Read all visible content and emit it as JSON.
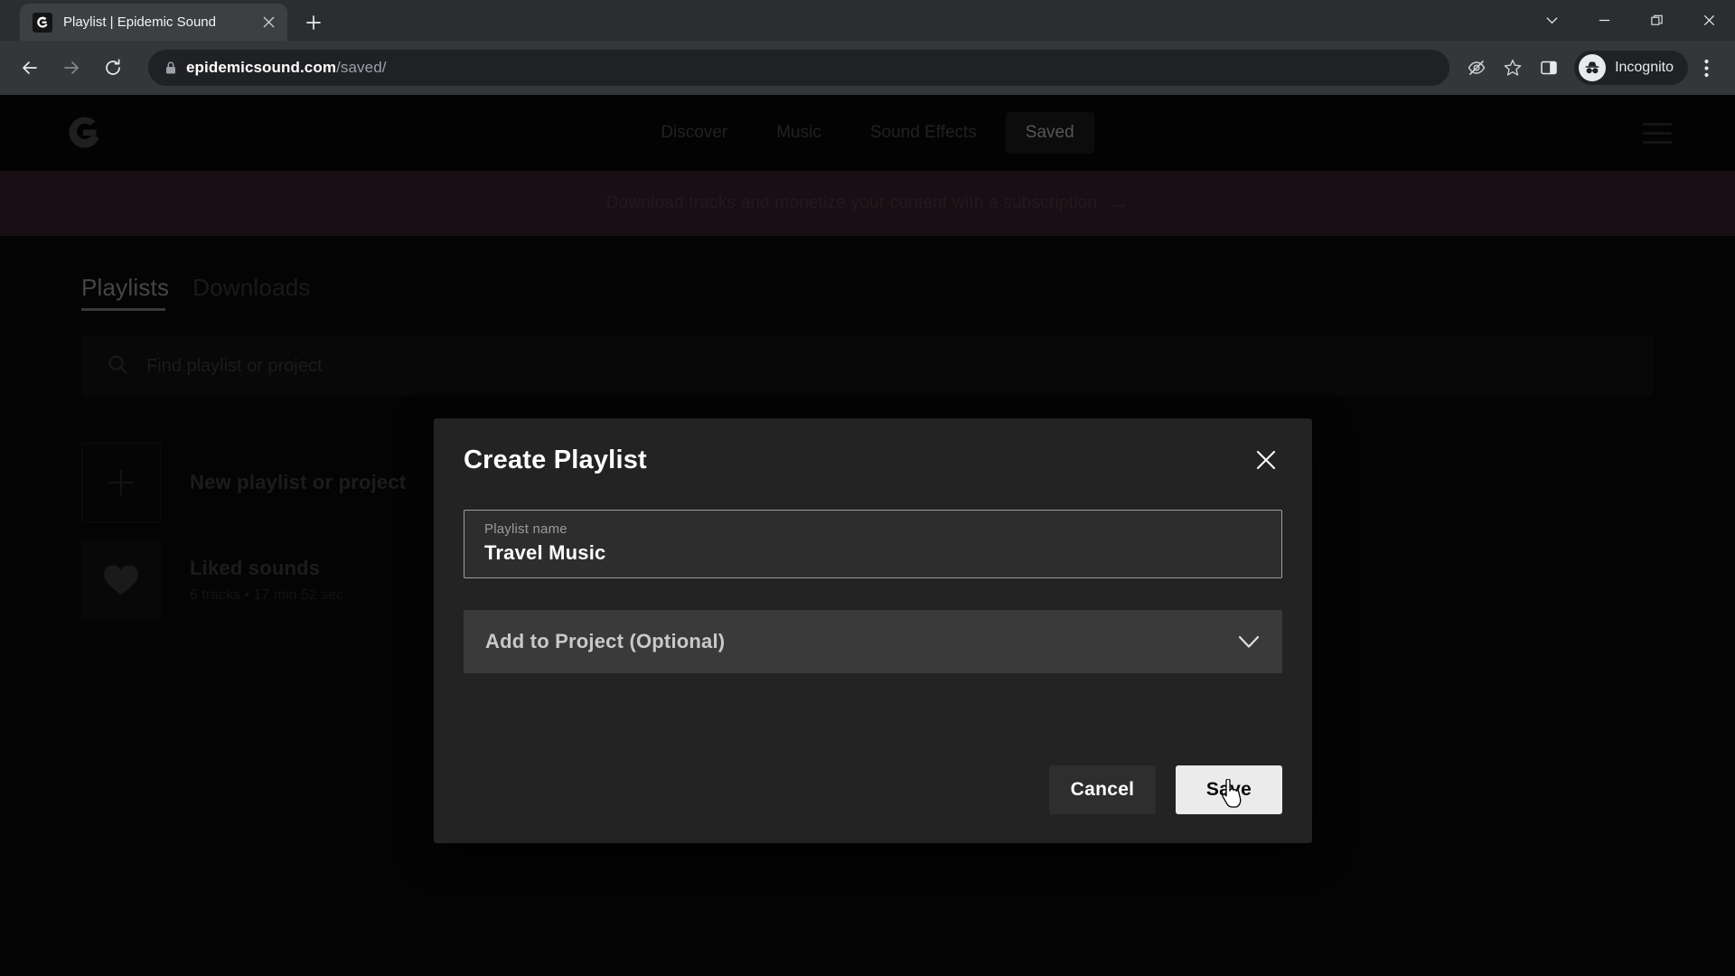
{
  "browser": {
    "tab": {
      "title": "Playlist | Epidemic Sound",
      "favicon_icon": "epidemic-sound-favicon",
      "close_icon": "close-icon"
    },
    "new_tab_label": "+",
    "window_controls": [
      {
        "name": "tab-search",
        "icon": "chevron-down-icon",
        "glyph": ""
      },
      {
        "name": "minimize",
        "icon": "minimize-icon",
        "glyph": ""
      },
      {
        "name": "maximize",
        "icon": "restore-icon",
        "glyph": ""
      },
      {
        "name": "close-window",
        "icon": "close-icon",
        "glyph": ""
      }
    ],
    "toolbar": {
      "back_icon": "back-arrow-icon",
      "forward_icon": "forward-arrow-icon",
      "reload_icon": "reload-icon",
      "lock_icon": "lock-icon",
      "url_domain": "epidemicsound.com",
      "url_path": "/saved/",
      "third_party_cookies_icon": "eye-slash-icon",
      "bookmark_icon": "star-icon",
      "side_panel_icon": "side-panel-icon",
      "incognito_label": "Incognito",
      "incognito_icon": "incognito-hat-icon",
      "menu_icon": "three-dot-menu-icon"
    }
  },
  "site": {
    "logo_icon": "epidemic-sound-logo",
    "nav": [
      {
        "label": "Discover",
        "active": false
      },
      {
        "label": "Music",
        "active": false
      },
      {
        "label": "Sound Effects",
        "active": false
      },
      {
        "label": "Saved",
        "active": true
      }
    ],
    "menu_icon": "hamburger-menu-icon",
    "promo": {
      "text": "Download tracks and monetize your content with a subscription",
      "arrow": "→",
      "bg_color": "#36212c"
    },
    "tabs": [
      {
        "label": "Playlists",
        "active": true
      },
      {
        "label": "Downloads",
        "active": false
      }
    ],
    "search": {
      "placeholder": "Find playlist or project",
      "icon": "search-icon",
      "value": ""
    },
    "playlists": [
      {
        "icon": "plus-icon",
        "title": "New playlist or project",
        "subtitle": ""
      },
      {
        "icon": "heart-icon",
        "title": "Liked sounds",
        "subtitle": "6 tracks • 17 min 52 sec"
      }
    ]
  },
  "modal": {
    "title": "Create Playlist",
    "close_icon": "close-icon",
    "name_field": {
      "label": "Playlist name",
      "value": "Travel Music"
    },
    "project_select": {
      "label": "Add to Project (Optional)",
      "chevron_icon": "chevron-down-icon"
    },
    "cancel_label": "Cancel",
    "save_label": "Save"
  },
  "colors": {
    "page_bg": "#0a0a0a",
    "modal_bg": "#232323",
    "save_btn_bg": "#ebebeb",
    "promo_bg": "#36212c",
    "browser_toolbar": "#35363a"
  }
}
